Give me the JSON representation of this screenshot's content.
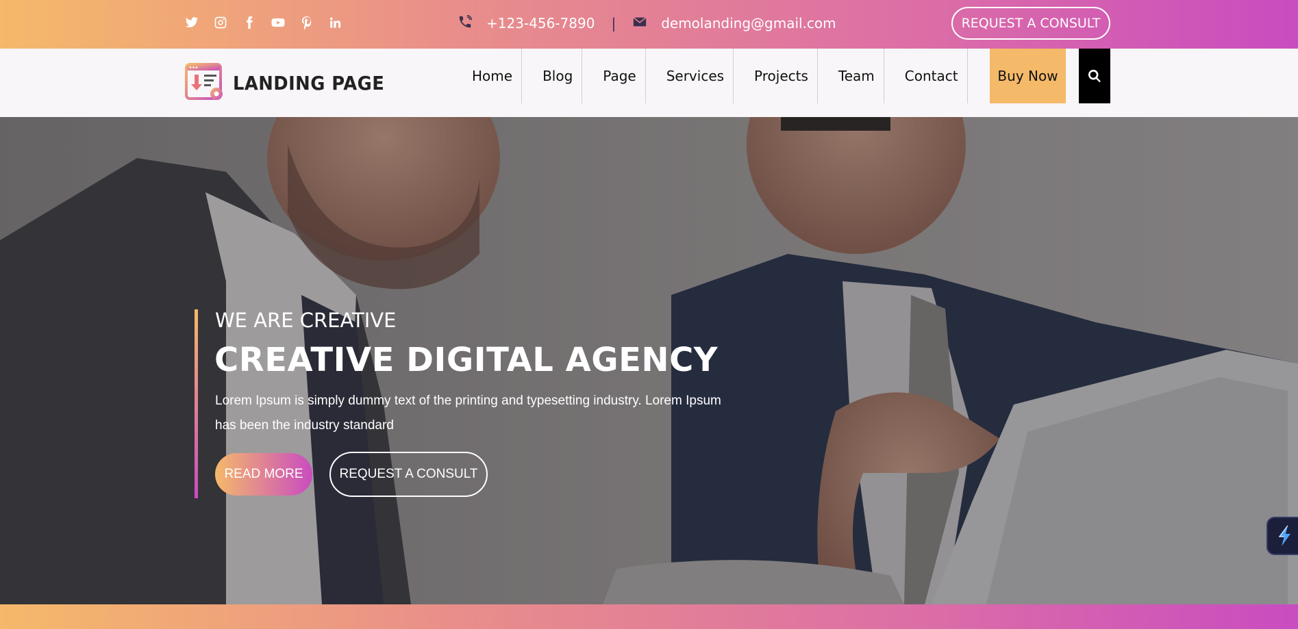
{
  "topbar": {
    "social_icons": [
      "twitter-icon",
      "instagram-icon",
      "facebook-icon",
      "youtube-icon",
      "pinterest-icon",
      "linkedin-icon"
    ],
    "phone": "+123-456-7890",
    "separator": "|",
    "email": "demolanding@gmail.com",
    "consult_button": "REQUEST A CONSULT"
  },
  "nav": {
    "logo_text": "LANDING PAGE",
    "items": [
      {
        "label": "Home"
      },
      {
        "label": "Blog"
      },
      {
        "label": "Page"
      },
      {
        "label": "Services"
      },
      {
        "label": "Projects"
      },
      {
        "label": "Team"
      },
      {
        "label": "Contact"
      }
    ],
    "buy_now": "Buy Now",
    "search_icon": "search-icon"
  },
  "hero": {
    "eyebrow": "WE ARE CREATIVE",
    "headline": "CREATIVE DIGITAL AGENCY",
    "lead": "Lorem Ipsum is simply dummy text of the printing and typesetting industry. Lorem Ipsum has been the industry standard",
    "read_more": "READ MORE",
    "consult_button": "REQUEST A CONSULT"
  },
  "colors": {
    "gradient_start": "#f5b96a",
    "gradient_mid": "#dc6fa5",
    "gradient_end": "#c94cc0",
    "nav_bg": "#f8f6f8",
    "search_bg": "#000000",
    "buy_now_bg": "#f5b96a"
  }
}
